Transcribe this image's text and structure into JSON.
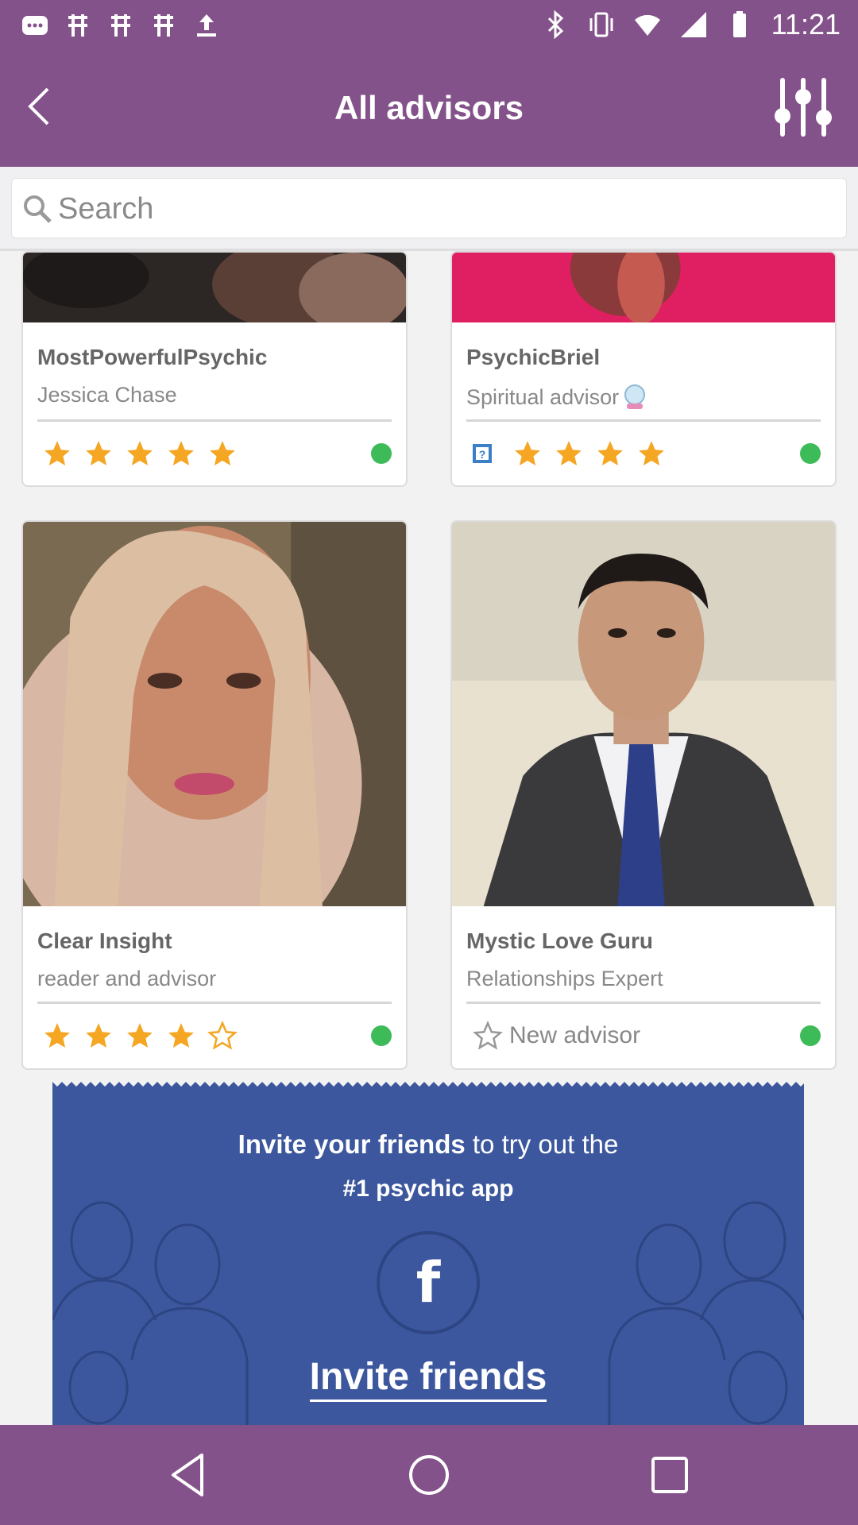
{
  "status_bar": {
    "time": "11:21"
  },
  "header": {
    "title": "All advisors"
  },
  "search": {
    "placeholder": "Search"
  },
  "advisors": [
    {
      "name": "MostPowerfulPsychic",
      "subtitle": "Jessica Chase",
      "rating": 5,
      "online": true
    },
    {
      "name": "PsychicBriel",
      "subtitle": "Spiritual advisor",
      "rating": 4,
      "online": true
    },
    {
      "name": "Clear Insight",
      "subtitle": "reader and advisor",
      "rating": 4,
      "online": true
    },
    {
      "name": "Mystic Love Guru",
      "subtitle": "Relationships Expert",
      "rating_text": "New advisor",
      "online": true
    }
  ],
  "invite": {
    "line1_bold": "Invite your friends",
    "line1_rest": " to try out the",
    "line2": "#1 psychic app",
    "fb_glyph": "f",
    "link": "Invite friends"
  },
  "colors": {
    "brand": "#84528a",
    "facebook": "#3c579d",
    "star": "#f5a623",
    "online": "#3dbb58"
  }
}
